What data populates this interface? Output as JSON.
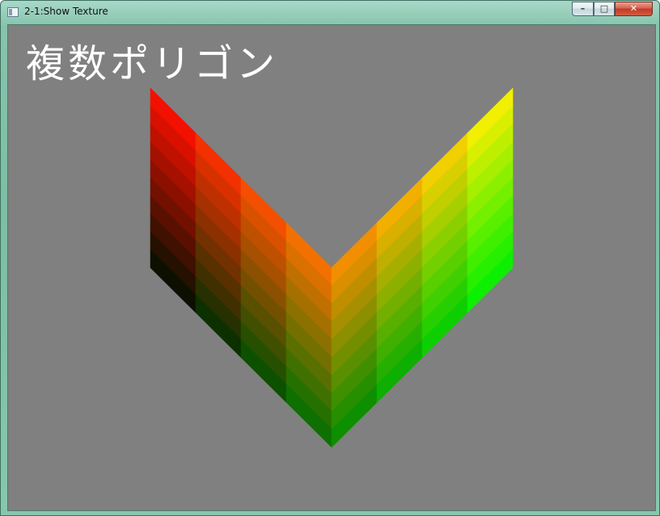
{
  "window": {
    "title": "2-1:Show Texture",
    "buttons": {
      "minimize": "–",
      "maximize": "□",
      "close": "✕"
    }
  },
  "client": {
    "background": "#808080",
    "caption": "複数ポリゴン",
    "caption_color": "#ffffff"
  },
  "polygons": {
    "columns": 8,
    "rows": 10,
    "colors": {
      "top_left": "#ff0000",
      "bottom_left": "#000000",
      "top_right": "#ffff00",
      "bottom_right": "#00ff00"
    }
  }
}
